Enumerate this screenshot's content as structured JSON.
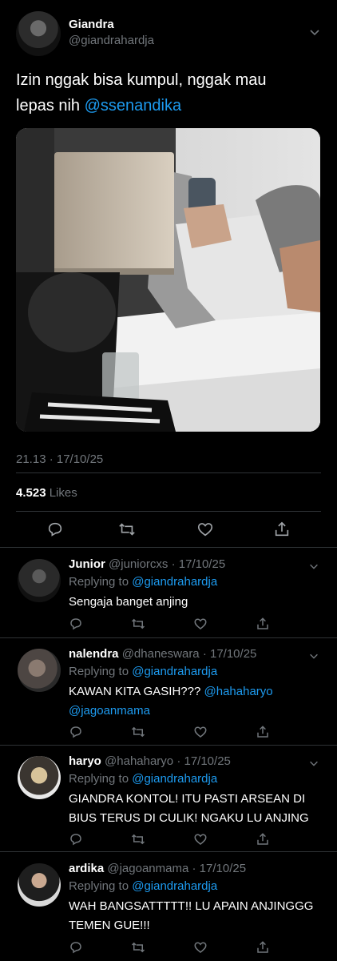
{
  "tweet": {
    "display_name": "Giandra",
    "handle": "@giandrahardja",
    "text_line1": "Izin nggak bisa kumpul, nggak mau",
    "text_line2_prefix": "lepas nih ",
    "mention": "@ssenandika",
    "time": "21.13 · 17/10/25",
    "likes_count": "4.523",
    "likes_label": "Likes"
  },
  "replies": [
    {
      "name": "Junior",
      "handle": "@juniorcxs",
      "date": "· 17/10/25",
      "replying_prefix": "Replying to ",
      "replying_to": "@giandrahardja",
      "text": "Sengaja banget anjing",
      "mentions": ""
    },
    {
      "name": "nalendra",
      "handle": "@dhaneswara",
      "date": "· 17/10/25",
      "replying_prefix": "Replying to ",
      "replying_to": "@giandrahardja",
      "text": "KAWAN KITA GASIH??? ",
      "mentions": "@hahaharyo @jagoanmama"
    },
    {
      "name": "haryo",
      "handle": "@hahaharyo",
      "date": "· 17/10/25",
      "replying_prefix": "Replying to ",
      "replying_to": "@giandrahardja",
      "text": "GIANDRA KONTOL! ITU PASTI ARSEAN DI BIUS TERUS DI CULIK! NGAKU LU ANJING",
      "mentions": ""
    },
    {
      "name": "ardika",
      "handle": "@jagoanmama",
      "date": "· 17/10/25",
      "replying_prefix": "Replying to ",
      "replying_to": "@giandrahardja",
      "text": "WAH BANGSATTTTT!! LU APAIN ANJINGGG TEMEN GUE!!!",
      "mentions": ""
    }
  ],
  "colors": {
    "background": "#000000",
    "link": "#1d9bf0",
    "muted": "#71767b",
    "divider": "#2f3336"
  }
}
